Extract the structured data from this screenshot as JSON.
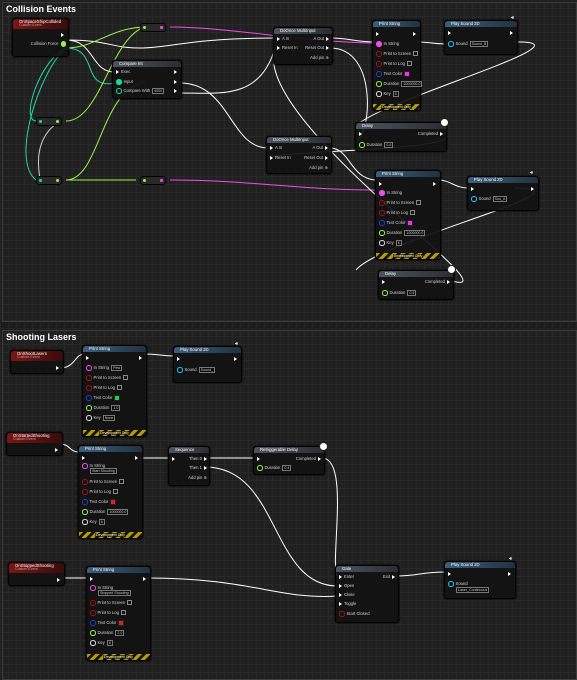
{
  "comments": {
    "collision": "Collision Events",
    "shooting": "Shooting Lasers"
  },
  "labels": {
    "print_string": "Print String",
    "play_sound_2d": "Play Sound 2D",
    "in_string": "In String",
    "print_to_screen": "Print to Screen",
    "print_to_log": "Print to Log",
    "text_color": "Text Color",
    "duration": "Duration",
    "key": "Key",
    "sound": "Sound",
    "development_only": "Development Only",
    "delay": "Delay",
    "completed": "Completed",
    "do_once_multi": "DoOnce MultiInput",
    "a_in": "A In",
    "a_out": "A Out",
    "reset_in": "Reset In",
    "reset_out": "Reset Out",
    "add_pin": "Add pin",
    "compare_int": "Compare Int",
    "exec": "Exec",
    "input": "Input",
    "compare_with": "Compare With",
    "sequence": "Sequence",
    "then0": "Then 0",
    "then1": "Then 1",
    "retriggerable_delay": "Retriggerable Delay",
    "gate": "Gate",
    "enter": "Enter",
    "exit": "Exit",
    "open": "Open",
    "close": "Close",
    "toggle": "Toggle",
    "start_closed": "Start Closed",
    "custom_event": "Custom Event"
  },
  "events": {
    "collided": "OnSpaceShipCollided",
    "collision_force": "Collision Force",
    "lasers": "OnShootLasers",
    "started": "OnStartedShooting",
    "stopped": "OnStoppedShooting"
  },
  "values": {
    "compare_with": "4000",
    "duration_a": "1000000.0",
    "key_a": "5",
    "duration_b": "1000000.0",
    "key_b": "6",
    "delay_a": "0.5",
    "delay_b": "0.5",
    "sound_a": "Sound_B",
    "sound_b": "Sou_A",
    "sound_c": "Sound_",
    "sound_d": "Laser_Continuous",
    "lasers_text": "Pew",
    "lasers_duration": "1.0",
    "lasers_key": "None",
    "started_text": "Start Shooting",
    "started_duration": "1000000.0",
    "started_key": "8",
    "stopped_text": "Stopped Shooting",
    "stopped_duration": "2.0",
    "stopped_key": "8",
    "retrig_duration": "0.4"
  },
  "colors": {
    "exec_wire": "#ffffff",
    "bool_pin": "#9c1414",
    "int_pin": "#22d6a0",
    "float_pin": "#9af04b",
    "string_pin": "#f04ee6",
    "color_pin": "#1f3fbf",
    "text_color_magenta": "#f030f0",
    "text_color_green": "#20d040",
    "text_color_red": "#e02020",
    "event_header": "#7a1616"
  }
}
